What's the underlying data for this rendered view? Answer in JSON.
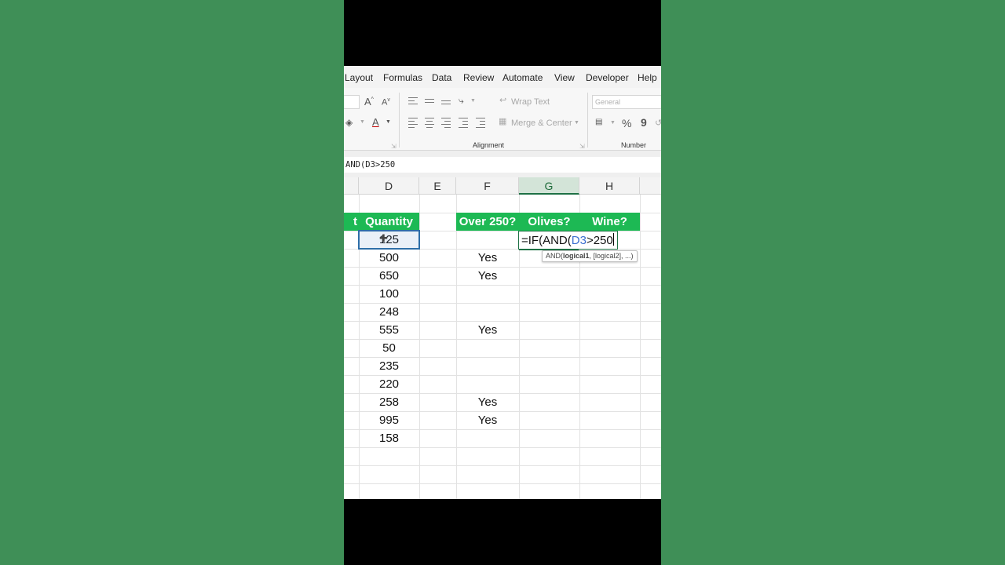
{
  "menu": [
    "Layout",
    "Formulas",
    "Data",
    "Review",
    "Automate",
    "View",
    "Developer",
    "Help"
  ],
  "ribbon": {
    "wrap_text": "Wrap Text",
    "merge_center": "Merge & Center",
    "alignment_label": "Alignment",
    "number_format": "General",
    "number_label": "Number",
    "percent": "%",
    "comma": "9"
  },
  "formula_bar": {
    "text": "AND(D3>250"
  },
  "columns": [
    "D",
    "E",
    "F",
    "G",
    "H"
  ],
  "headers": {
    "partial_prev": "t",
    "quantity": "Quantity",
    "over250": "Over 250?",
    "olives": "Olives?",
    "wine": "Wine?"
  },
  "rows": [
    {
      "quantity": "125",
      "over250": ""
    },
    {
      "quantity": "500",
      "over250": "Yes"
    },
    {
      "quantity": "650",
      "over250": "Yes"
    },
    {
      "quantity": "100",
      "over250": ""
    },
    {
      "quantity": "248",
      "over250": ""
    },
    {
      "quantity": "555",
      "over250": "Yes"
    },
    {
      "quantity": "50",
      "over250": ""
    },
    {
      "quantity": "235",
      "over250": ""
    },
    {
      "quantity": "220",
      "over250": ""
    },
    {
      "quantity": "258",
      "over250": "Yes"
    },
    {
      "quantity": "995",
      "over250": "Yes"
    },
    {
      "quantity": "158",
      "over250": ""
    }
  ],
  "editing": {
    "prefix": "=IF(AND(",
    "ref": "D3",
    "suffix": ">250"
  },
  "tooltip": {
    "fn": "AND(",
    "arg1": "logical1",
    "rest": ", [logical2], ...)"
  },
  "colors": {
    "header_green": "#1db954",
    "background_green": "#3f8f57",
    "selection_blue": "#2e6ea8",
    "excel_green": "#1e7145"
  }
}
